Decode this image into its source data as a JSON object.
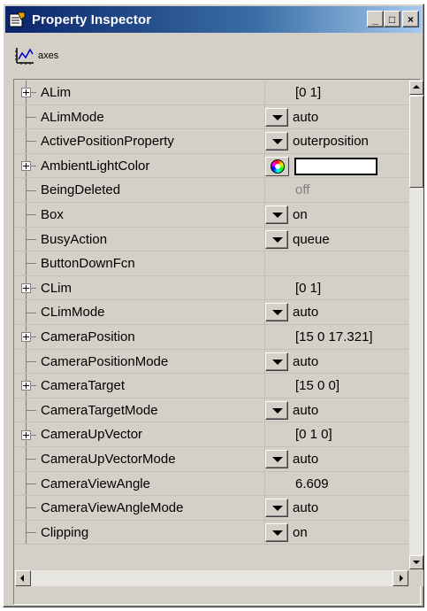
{
  "window": {
    "title": "Property Inspector",
    "controls": {
      "minimize": "_",
      "maximize": "□",
      "close": "×"
    }
  },
  "object": {
    "label": "axes",
    "icon": "axes-plot-icon"
  },
  "properties": [
    {
      "name": "ALim",
      "value": "[0 1]",
      "kind": "text",
      "expandable": true
    },
    {
      "name": "ALimMode",
      "value": "auto",
      "kind": "dropdown",
      "expandable": false
    },
    {
      "name": "ActivePositionProperty",
      "value": "outerposition",
      "kind": "dropdown",
      "expandable": false
    },
    {
      "name": "AmbientLightColor",
      "value": "",
      "kind": "color",
      "color": "#ffffff",
      "expandable": true
    },
    {
      "name": "BeingDeleted",
      "value": "off",
      "kind": "readonly",
      "expandable": false
    },
    {
      "name": "Box",
      "value": "on",
      "kind": "dropdown",
      "expandable": false
    },
    {
      "name": "BusyAction",
      "value": "queue",
      "kind": "dropdown",
      "expandable": false
    },
    {
      "name": "ButtonDownFcn",
      "value": "",
      "kind": "text",
      "expandable": false
    },
    {
      "name": "CLim",
      "value": "[0 1]",
      "kind": "text",
      "expandable": true
    },
    {
      "name": "CLimMode",
      "value": "auto",
      "kind": "dropdown",
      "expandable": false
    },
    {
      "name": "CameraPosition",
      "value": "[15 0 17.321]",
      "kind": "text",
      "expandable": true
    },
    {
      "name": "CameraPositionMode",
      "value": "auto",
      "kind": "dropdown",
      "expandable": false
    },
    {
      "name": "CameraTarget",
      "value": "[15 0 0]",
      "kind": "text",
      "expandable": true
    },
    {
      "name": "CameraTargetMode",
      "value": "auto",
      "kind": "dropdown",
      "expandable": false
    },
    {
      "name": "CameraUpVector",
      "value": "[0 1 0]",
      "kind": "text",
      "expandable": true
    },
    {
      "name": "CameraUpVectorMode",
      "value": "auto",
      "kind": "dropdown",
      "expandable": false
    },
    {
      "name": "CameraViewAngle",
      "value": "6.609",
      "kind": "text",
      "expandable": false
    },
    {
      "name": "CameraViewAngleMode",
      "value": "auto",
      "kind": "dropdown",
      "expandable": false
    },
    {
      "name": "Clipping",
      "value": "on",
      "kind": "dropdown",
      "expandable": false
    }
  ]
}
